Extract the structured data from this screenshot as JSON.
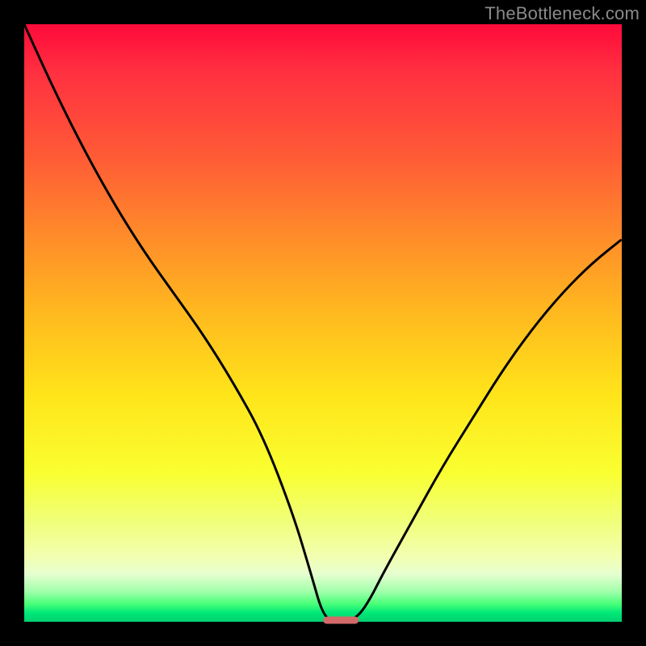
{
  "watermark": {
    "text": "TheBottleneck.com"
  },
  "colors": {
    "background": "#000000",
    "curve_stroke": "#000000",
    "marker_fill": "#d36a6a",
    "watermark": "#8a8a8a"
  },
  "chart_data": {
    "type": "line",
    "title": "",
    "xlabel": "",
    "ylabel": "",
    "xlim": [
      0,
      100
    ],
    "ylim": [
      0,
      100
    ],
    "grid": false,
    "legend": false,
    "x": [
      0,
      5,
      10,
      15,
      20,
      25,
      30,
      35,
      40,
      45,
      48,
      50,
      52,
      54,
      56,
      58,
      60,
      65,
      70,
      75,
      80,
      85,
      90,
      95,
      100
    ],
    "values": [
      100,
      89,
      79,
      70,
      62,
      55,
      48,
      40,
      31,
      18,
      8,
      1,
      0,
      0,
      1,
      4,
      8,
      17,
      26,
      34,
      42,
      49,
      55,
      60,
      64
    ],
    "marker": {
      "x": 53,
      "y": 0,
      "width": 6,
      "height": 1.2
    },
    "note": "V-shaped bottleneck curve on a vertical rainbow gradient; minimum lies slightly right of center. Values are visual estimates of normalized height (0 = bottom/green, 100 = top/red)."
  }
}
